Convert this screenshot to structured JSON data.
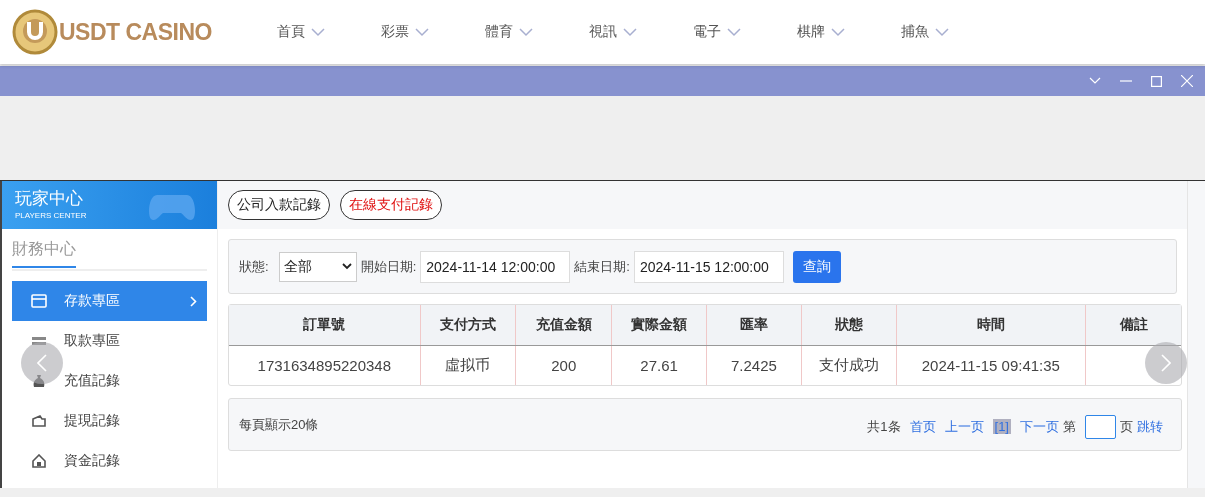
{
  "header": {
    "logo": "USDT CASINO",
    "nav": [
      "首頁",
      "彩票",
      "體育",
      "視訊",
      "電子",
      "棋牌",
      "捕魚"
    ]
  },
  "sidebar": {
    "title": "玩家中心",
    "subtitle": "PLAYERS CENTER",
    "section": "財務中心",
    "items": [
      {
        "label": "存款專區",
        "selected": true,
        "kind": "card"
      },
      {
        "label": "取款專區",
        "selected": false,
        "kind": "cash"
      },
      {
        "label": "充值記錄",
        "selected": false,
        "kind": "bag"
      },
      {
        "label": "提現記錄",
        "selected": false,
        "kind": "wallet"
      },
      {
        "label": "資金記錄",
        "selected": false,
        "kind": "safe"
      }
    ]
  },
  "tabs": [
    {
      "label": "公司入款記錄",
      "selected": false
    },
    {
      "label": "在線支付記錄",
      "selected": true
    }
  ],
  "filter": {
    "status_label": "狀態:",
    "status_value": "全部",
    "start_label": "開始日期:",
    "start_value": "2024-11-14 12:00:00",
    "end_label": "結束日期:",
    "end_value": "2024-11-15 12:00:00",
    "query": "查詢"
  },
  "table": {
    "columns": [
      "訂單號",
      "支付方式",
      "充值金額",
      "實際金額",
      "匯率",
      "狀態",
      "時間",
      "備註"
    ],
    "rows": [
      [
        "1731634895220348",
        "虛拟币",
        "200",
        "27.61",
        "7.2425",
        "支付成功",
        "2024-11-15 09:41:35",
        ""
      ]
    ]
  },
  "pagination": {
    "per_page": "每頁顯示20條",
    "total": "共1条",
    "first": "首页",
    "prev": "上一页",
    "current": "[1]",
    "next": "下一页",
    "page_label": "第",
    "page_suffix": "页",
    "jump": "跳转"
  }
}
